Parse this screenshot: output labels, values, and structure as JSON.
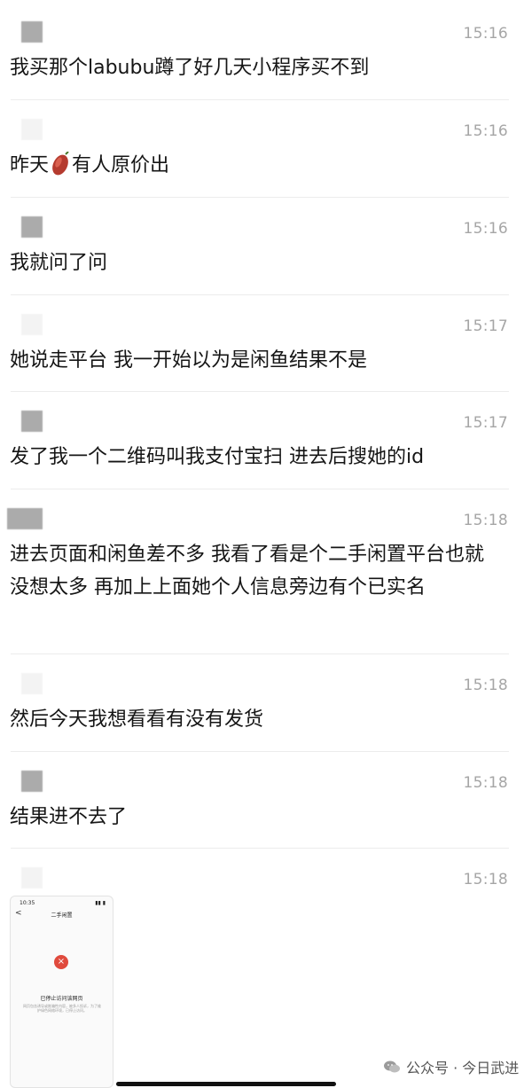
{
  "messages": [
    {
      "time": "15:16",
      "text": "我买那个labubu蹲了好几天小程序买不到",
      "avatar": "blurred"
    },
    {
      "time": "15:16",
      "text_before": "昨天",
      "emoji": "sweet-potato-emoji",
      "text_after": "有人原价出",
      "avatar": "blank"
    },
    {
      "time": "15:16",
      "text": "我就问了问",
      "avatar": "blurred"
    },
    {
      "time": "15:17",
      "text": "她说走平台 我一开始以为是闲鱼结果不是",
      "avatar": "blank"
    },
    {
      "time": "15:17",
      "text": "发了我一个二维码叫我支付宝扫 进去后搜她的id",
      "avatar": "blurred"
    },
    {
      "time": "15:18",
      "text": "进去页面和闲鱼差不多 我看了看是个二手闲置平台也就没想太多 再加上上面她个人信息旁边有个已实名",
      "avatar": "blurred"
    },
    {
      "time": "15:18",
      "text": "然后今天我想看看有没有发货",
      "avatar": "blank"
    },
    {
      "time": "15:18",
      "text": "结果进不去了",
      "avatar": "blurred"
    },
    {
      "time": "15:18",
      "avatar": "blank"
    }
  ],
  "screenshot": {
    "status_time": "10:35",
    "status_icons": "▮▮ ▮",
    "back": "<",
    "title": "二手闲置",
    "error_icon": "×",
    "message": "已停止访问该网页",
    "sub": "网页包含诱导或欺骗性内容，被多人投诉，为了维护绿色网络环境，已停止访问。"
  },
  "watermark": {
    "text": "公众号 · 今日武进",
    "icon": "wechat-icon"
  },
  "colors": {
    "time": "#a6a6a6",
    "text": "#151515",
    "separator": "#ececec",
    "error": "#e04a3d"
  }
}
